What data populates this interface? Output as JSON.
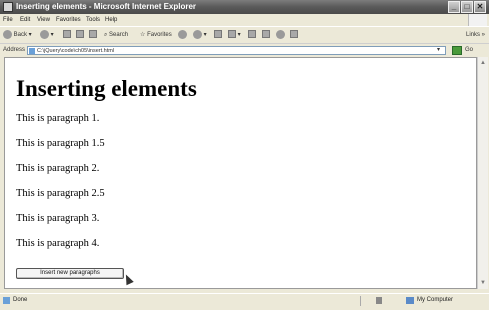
{
  "window": {
    "title": "Inserting elements - Microsoft Internet Explorer",
    "controls": {
      "minimize": "_",
      "maximize": "□",
      "close": "✕"
    }
  },
  "menu": [
    "File",
    "Edit",
    "View",
    "Favorites",
    "Tools",
    "Help"
  ],
  "toolbar": {
    "back_label": "Back",
    "search_label": "Search",
    "favorites_label": "Favorites",
    "links_label": "Links"
  },
  "address": {
    "label": "Address",
    "url": "C:\\jQuery\\code\\ch05\\insert.html",
    "go_label": "Go"
  },
  "page": {
    "heading": "Inserting elements",
    "paragraphs": [
      "This is paragraph 1.",
      "This is paragraph 1.5",
      "This is paragraph 2.",
      "This is paragraph 2.5",
      "This is paragraph 3.",
      "This is paragraph 4."
    ],
    "button_label": "Insert new paragraphs"
  },
  "status": {
    "text": "Done",
    "zone": "My Computer"
  }
}
